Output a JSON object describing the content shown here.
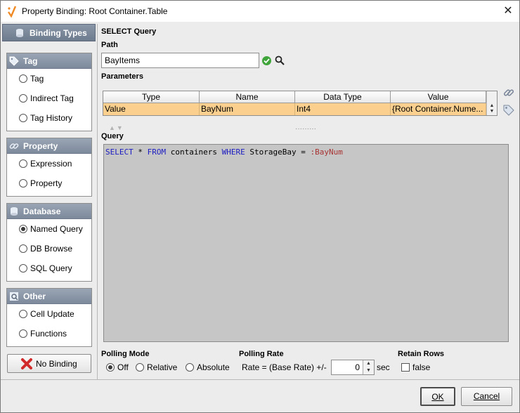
{
  "window": {
    "title": "Property Binding: Root Container.Table"
  },
  "binding_types": {
    "header": "Binding Types",
    "groups": [
      {
        "label": "Tag",
        "options": [
          {
            "label": "Tag",
            "selected": false
          },
          {
            "label": "Indirect Tag",
            "selected": false
          },
          {
            "label": "Tag History",
            "selected": false
          }
        ]
      },
      {
        "label": "Property",
        "options": [
          {
            "label": "Expression",
            "selected": false
          },
          {
            "label": "Property",
            "selected": false
          }
        ]
      },
      {
        "label": "Database",
        "options": [
          {
            "label": "Named Query",
            "selected": true
          },
          {
            "label": "DB Browse",
            "selected": false
          },
          {
            "label": "SQL Query",
            "selected": false
          }
        ]
      },
      {
        "label": "Other",
        "options": [
          {
            "label": "Cell Update",
            "selected": false
          },
          {
            "label": "Functions",
            "selected": false
          }
        ]
      }
    ],
    "no_binding_label": "No Binding"
  },
  "select_query": {
    "heading": "SELECT Query",
    "path_label": "Path",
    "path_value": "BayItems",
    "parameters_label": "Parameters",
    "columns": [
      "Type",
      "Name",
      "Data Type",
      "Value"
    ],
    "rows": [
      [
        "Value",
        "BayNum",
        "Int4",
        "{Root Container.Nume..."
      ]
    ],
    "query_label": "Query",
    "query_text": {
      "k1": "SELECT",
      "t1": " * ",
      "k2": "FROM",
      "t2": " containers ",
      "k3": "WHERE",
      "t3": " StorageBay = ",
      "p1": ":BayNum"
    }
  },
  "polling": {
    "mode_label": "Polling Mode",
    "modes": [
      {
        "label": "Off",
        "selected": true
      },
      {
        "label": "Relative",
        "selected": false
      },
      {
        "label": "Absolute",
        "selected": false
      }
    ],
    "rate_label": "Polling Rate",
    "rate_prefix": "Rate = (Base Rate) +/-",
    "rate_value": "0",
    "rate_unit": "sec",
    "retain_label": "Retain Rows",
    "retain_value": "false"
  },
  "buttons": {
    "ok": "OK",
    "cancel": "Cancel"
  }
}
